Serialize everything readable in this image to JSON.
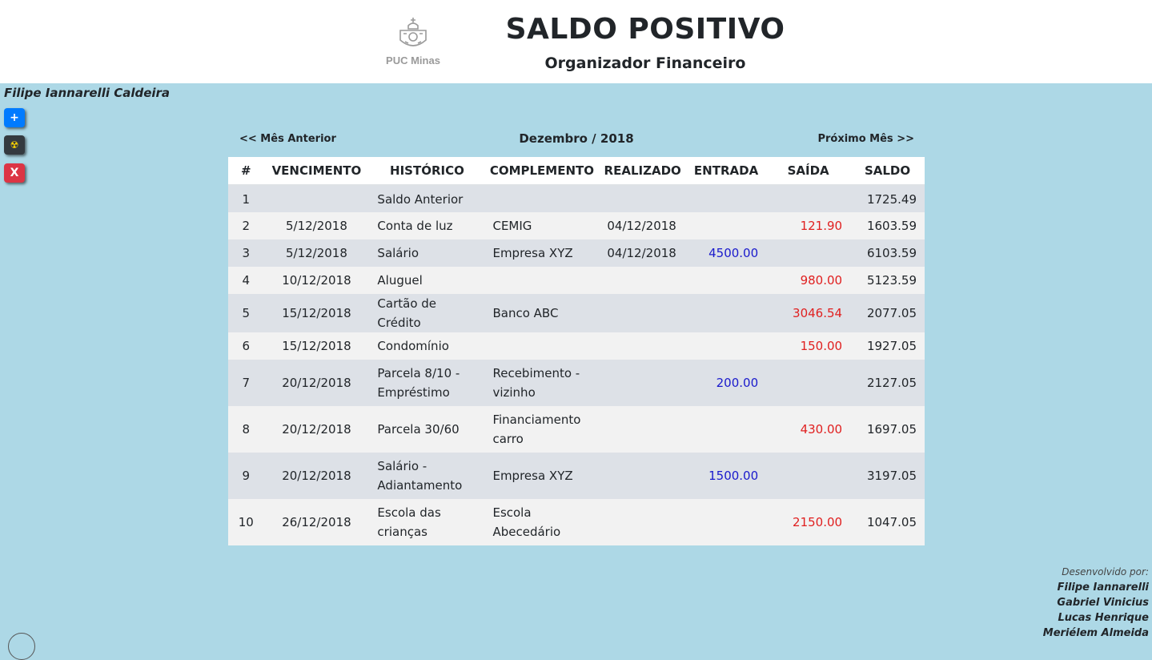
{
  "header": {
    "logo_text": "PUC Minas",
    "title": "SALDO POSITIVO",
    "subtitle": "Organizador Financeiro"
  },
  "user": {
    "name": "Filipe Iannarelli Caldeira"
  },
  "side_buttons": {
    "add_label": "+",
    "nuke_label": "☢",
    "close_label": "X"
  },
  "nav": {
    "prev_label": "<< Mês Anterior",
    "next_label": "Próximo Mês >>",
    "month_title": "Dezembro / 2018"
  },
  "table": {
    "headers": [
      "#",
      "VENCIMENTO",
      "HISTÓRICO",
      "COMPLEMENTO",
      "REALIZADO",
      "ENTRADA",
      "SAÍDA",
      "SALDO"
    ],
    "rows": [
      [
        "1",
        "",
        "Saldo Anterior",
        "",
        "",
        "",
        "",
        "1725.49"
      ],
      [
        "2",
        "5/12/2018",
        "Conta de luz",
        "CEMIG",
        "04/12/2018",
        "",
        "121.90",
        "1603.59"
      ],
      [
        "3",
        "5/12/2018",
        "Salário",
        "Empresa XYZ",
        "04/12/2018",
        "4500.00",
        "",
        "6103.59"
      ],
      [
        "4",
        "10/12/2018",
        "Aluguel",
        "",
        "",
        "",
        "980.00",
        "5123.59"
      ],
      [
        "5",
        "15/12/2018",
        "Cartão de Crédito",
        "Banco ABC",
        "",
        "",
        "3046.54",
        "2077.05"
      ],
      [
        "6",
        "15/12/2018",
        "Condomínio",
        "",
        "",
        "",
        "150.00",
        "1927.05"
      ],
      [
        "7",
        "20/12/2018",
        "Parcela 8/10 - Empréstimo",
        "Recebimento - vizinho",
        "",
        "200.00",
        "",
        "2127.05"
      ],
      [
        "8",
        "20/12/2018",
        "Parcela 30/60",
        "Financiamento carro",
        "",
        "",
        "430.00",
        "1697.05"
      ],
      [
        "9",
        "20/12/2018",
        "Salário - Adiantamento",
        "Empresa XYZ",
        "",
        "1500.00",
        "",
        "3197.05"
      ],
      [
        "10",
        "26/12/2018",
        "Escola das crianças",
        "Escola Abecedário",
        "",
        "",
        "2150.00",
        "1047.05"
      ]
    ]
  },
  "credits": {
    "label": "Desenvolvido por:",
    "names": [
      "Filipe Iannarelli",
      "Gabriel Vinicius",
      "Lucas Henrique",
      "Meriélem Almeida"
    ]
  },
  "colors": {
    "background": "#add8e6",
    "entrada": "#1a1acc",
    "saida": "#e02020",
    "add_button": "#007bff",
    "close_button": "#dc3545"
  },
  "icons": [
    "puc-minas-crest-icon",
    "radiation-icon"
  ]
}
